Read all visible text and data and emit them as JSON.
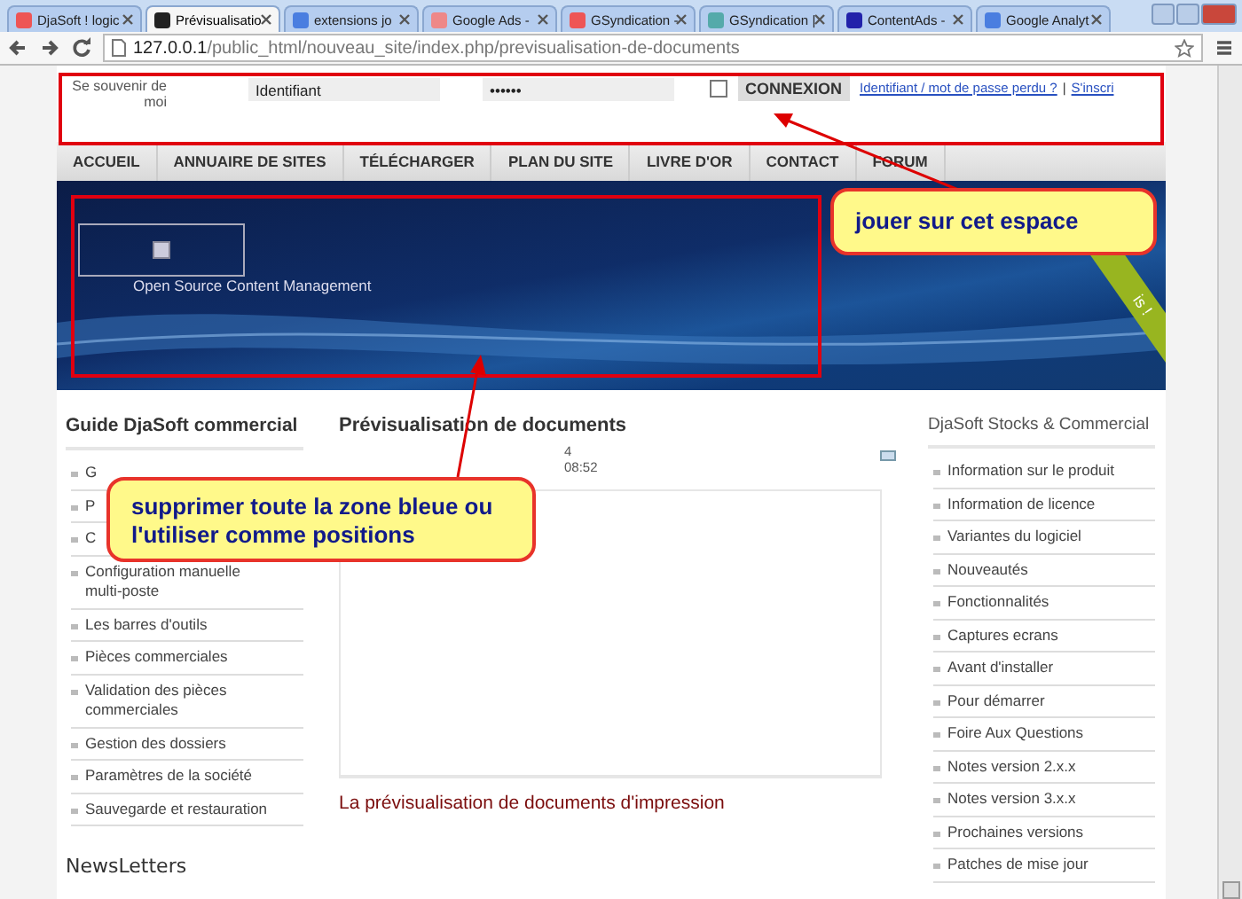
{
  "browser": {
    "tabs": [
      {
        "label": "DjaSoft ! logic",
        "selected": false
      },
      {
        "label": "Prévisualisatio",
        "selected": true
      },
      {
        "label": "extensions jo",
        "selected": false
      },
      {
        "label": "Google Ads -",
        "selected": false
      },
      {
        "label": "GSyndication -",
        "selected": false
      },
      {
        "label": "GSyndication |",
        "selected": false
      },
      {
        "label": "ContentAds -",
        "selected": false
      },
      {
        "label": "Google Analyt",
        "selected": false
      }
    ],
    "url_host": "127.0.0.1",
    "url_path": "/public_html/nouveau_site/index.php/previsualisation-de-documents"
  },
  "login": {
    "remember_label": "Se souvenir de moi",
    "username": "Identifiant",
    "password": "••••••",
    "remember_checked": false,
    "submit": "CONNEXION",
    "links": [
      "Identifiant / mot de passe perdu ?",
      "S'inscri"
    ],
    "separator": "|"
  },
  "nav": [
    "ACCUEIL",
    "ANNUAIRE DE SITES",
    "TÉLÉCHARGER",
    "PLAN DU SITE",
    "LIVRE D'OR",
    "CONTACT",
    "FORUM"
  ],
  "banner": {
    "tagline": "Open Source Content Management",
    "ribbon": "is !"
  },
  "left": {
    "title": "Guide DjaSoft commercial",
    "items": [
      "G",
      "P",
      "C",
      "Configuration manuelle multi-poste",
      "Les barres d'outils",
      "Pièces commerciales",
      "Validation des pièces commerciales",
      "Gestion des dossiers",
      "Paramètres de la société",
      "Sauvegarde et restauration"
    ],
    "next_title": "NewsLetters"
  },
  "main": {
    "title": "Prévisualisation de documents",
    "meta": [
      "4",
      "08:52"
    ],
    "article_title": "La prévisualisation de documents d'impression"
  },
  "right": {
    "title": "DjaSoft Stocks & Commercial",
    "items": [
      "Information sur le produit",
      "Information de licence",
      "Variantes du logiciel",
      "Nouveautés",
      "Fonctionnalités",
      "Captures ecrans",
      "Avant d'installer",
      "Pour démarrer",
      "Foire Aux Questions",
      "Notes version 2.x.x",
      "Notes version 3.x.x",
      "Prochaines versions",
      "Patches de mise jour"
    ]
  },
  "annotations": [
    {
      "text": "jouer sur cet espace"
    },
    {
      "text": "supprimer toute la zone bleue ou l'utiliser comme positions"
    }
  ]
}
